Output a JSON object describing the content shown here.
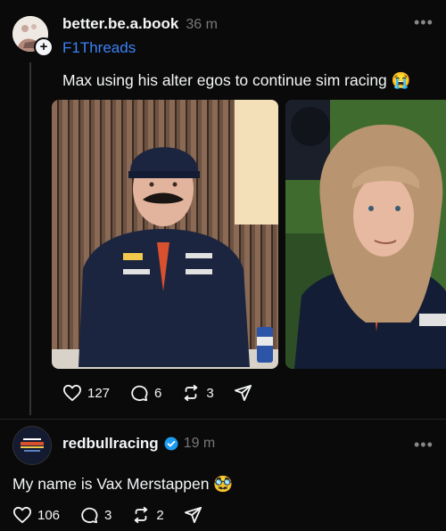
{
  "post1": {
    "username": "better.be.a.book",
    "time": "36 m",
    "feed": "F1Threads",
    "more_icon": "ellipsis-icon",
    "text": "Max using his alter egos to continue sim racing 😭",
    "likes": "127",
    "comments": "6",
    "reposts": "3"
  },
  "post2": {
    "username": "redbullracing",
    "time": "19 m",
    "verified": true,
    "text": "My name is Vax Merstappen 🥸",
    "likes": "106",
    "comments": "3",
    "reposts": "2"
  },
  "colors": {
    "background": "#0a0a0a",
    "text": "#f3f5f7",
    "muted": "#777777",
    "link": "#3b82f6",
    "verified": "#1d9bf0"
  }
}
